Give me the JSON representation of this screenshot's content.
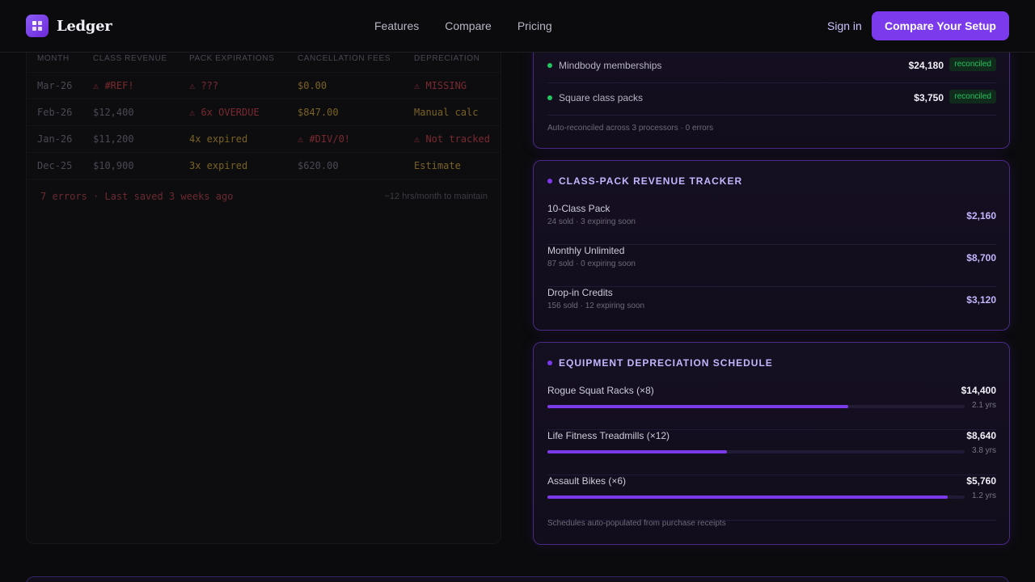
{
  "nav": {
    "brand": "Ledger",
    "links": [
      "Features",
      "Compare",
      "Pricing"
    ],
    "signin": "Sign in",
    "cta": "Compare Your Setup"
  },
  "sheet": {
    "headers": [
      "MONTH",
      "CLASS REVENUE",
      "PACK EXPIRATIONS",
      "CANCELLATION FEES",
      "DEPRECIATION"
    ],
    "rows": [
      [
        "Mar-26",
        "⚠ #REF!",
        "⚠ ???",
        "$0.00",
        "⚠ MISSING"
      ],
      [
        "Feb-26",
        "$12,400",
        "⚠ 6x OVERDUE",
        "$847.00",
        "Manual calc"
      ],
      [
        "Jan-26",
        "$11,200",
        "4x expired",
        "⚠ #DIV/0!",
        "⚠ Not tracked"
      ],
      [
        "Dec-25",
        "$10,900",
        "3x expired",
        "$620.00",
        "Estimate"
      ]
    ],
    "footer_left": "7 errors · Last saved 3 weeks ago",
    "footer_right": "~12 hrs/month to maintain"
  },
  "reconcile": {
    "rows": [
      {
        "label": "Mindbody memberships",
        "amount": "$24,180",
        "badge": "reconciled"
      },
      {
        "label": "Square class packs",
        "amount": "$3,750",
        "badge": "reconciled"
      }
    ],
    "note": "Auto-reconciled across 3 processors · 0 errors"
  },
  "packs": {
    "title": "CLASS-PACK REVENUE TRACKER",
    "rows": [
      {
        "name": "10-Class Pack",
        "sub": "24 sold · 3 expiring soon",
        "amount": "$2,160"
      },
      {
        "name": "Monthly Unlimited",
        "sub": "87 sold · 0 expiring soon",
        "amount": "$8,700"
      },
      {
        "name": "Drop-in Credits",
        "sub": "156 sold · 12 expiring soon",
        "amount": "$3,120"
      }
    ]
  },
  "equipment": {
    "title": "EQUIPMENT DEPRECIATION SCHEDULE",
    "rows": [
      {
        "name": "Rogue Squat Racks (×8)",
        "amount": "$14,400",
        "years": "2.1 yrs",
        "progress": 0.72
      },
      {
        "name": "Life Fitness Treadmills (×12)",
        "amount": "$8,640",
        "years": "3.8 yrs",
        "progress": 0.43
      },
      {
        "name": "Assault Bikes (×6)",
        "amount": "$5,760",
        "years": "1.2 yrs",
        "progress": 0.96
      }
    ],
    "note": "Schedules auto-populated from purchase receipts"
  },
  "colors": {
    "accent": "#7c3aed",
    "success": "#22c55e",
    "background": "#0b0b0d"
  }
}
